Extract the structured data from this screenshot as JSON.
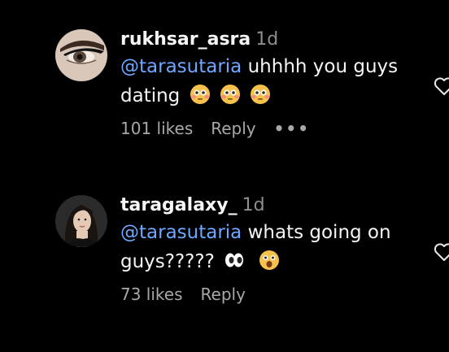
{
  "comments": [
    {
      "username": "rukhsar_asra",
      "time": "1d",
      "mention": "@tarasutaria",
      "text_line1": " uhhhh you guys",
      "text_line2": "dating",
      "emojis": [
        "flushed-face",
        "flushed-face",
        "flushed-face"
      ],
      "likes": "101 likes",
      "reply": "Reply",
      "more": "•••"
    },
    {
      "username": "taragalaxy_",
      "time": "1d",
      "mention": "@tarasutaria",
      "text_line1": " whats going on",
      "text_line2": "guys?????",
      "emojis": [
        "eyes",
        "face-with-open-mouth"
      ],
      "likes": "73 likes",
      "reply": "Reply"
    }
  ],
  "colors": {
    "background": "#000000",
    "mention": "#6fa6ff",
    "muted": "#8e8e8e"
  }
}
